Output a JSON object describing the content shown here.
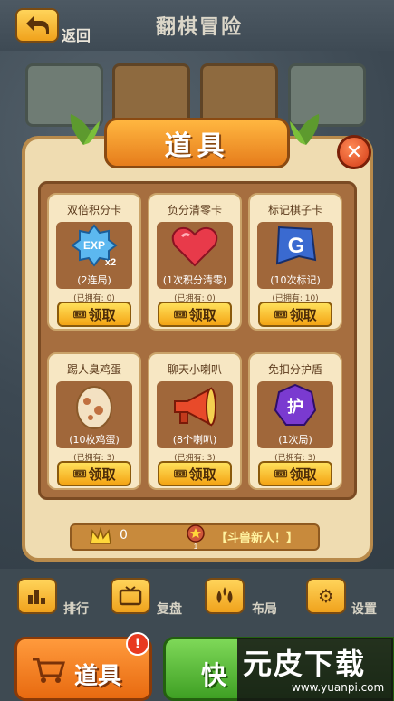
{
  "header": {
    "back_label": "返回",
    "title": "翻棋冒险"
  },
  "modal": {
    "title": "道具",
    "items": [
      {
        "name": "双倍积分卡",
        "desc": "(2连局)",
        "owned": "(已拥有: 0)",
        "button": "领取",
        "icon": "exp-x2-icon"
      },
      {
        "name": "负分清零卡",
        "desc": "(1次积分清零)",
        "owned": "(已拥有: 0)",
        "button": "领取",
        "icon": "heart-icon"
      },
      {
        "name": "标记棋子卡",
        "desc": "(10次标记)",
        "owned": "(已拥有: 10)",
        "button": "领取",
        "icon": "g-flag-icon"
      },
      {
        "name": "踢人臭鸡蛋",
        "desc": "(10枚鸡蛋)",
        "owned": "(已拥有: 3)",
        "button": "领取",
        "icon": "egg-icon"
      },
      {
        "name": "聊天小喇叭",
        "desc": "(8个喇叭)",
        "owned": "(已拥有: 3)",
        "button": "领取",
        "icon": "megaphone-icon"
      },
      {
        "name": "免扣分护盾",
        "desc": "(1次局)",
        "owned": "(已拥有: 3)",
        "button": "领取",
        "icon": "shield-icon"
      }
    ],
    "exp_text": "EXP",
    "x2_text": "x2",
    "g_text": "G",
    "shield_text": "护",
    "status": {
      "crowns": "0",
      "rank_badge": "1",
      "rank_title": "【斗兽新人！】"
    }
  },
  "bottom_nav": [
    {
      "label": "排行",
      "icon": "chart-icon"
    },
    {
      "label": "复盘",
      "icon": "tv-icon"
    },
    {
      "label": "布局",
      "icon": "drops-icon"
    },
    {
      "label": "设置",
      "icon": "gear-icon"
    }
  ],
  "actions": {
    "items_label": "道具",
    "alert": "!",
    "quick_label": "快"
  },
  "watermark": {
    "main": "元皮下载",
    "sub": "www.yuanpi.com"
  }
}
